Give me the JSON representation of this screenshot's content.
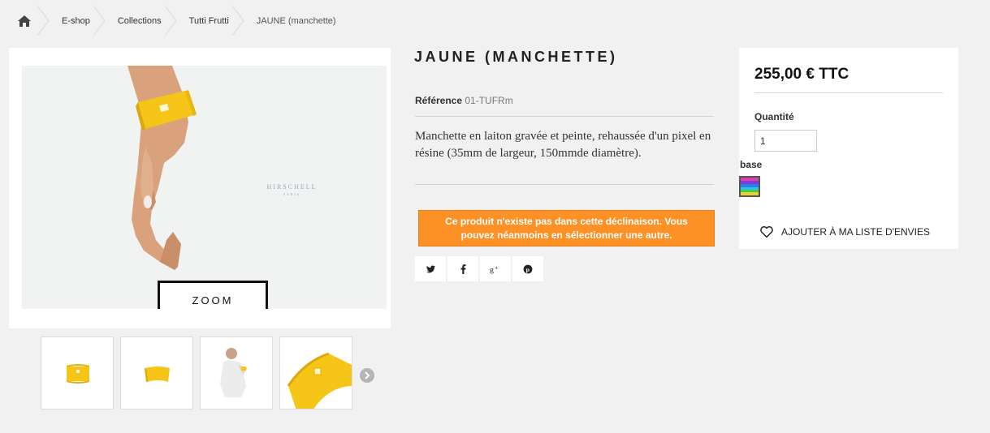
{
  "breadcrumb": {
    "home_icon": "home-icon",
    "items": [
      "E-shop",
      "Collections",
      "Tutti Frutti",
      "JAUNE (manchette)"
    ]
  },
  "gallery": {
    "zoom_label": "ZOOM",
    "brand_logo_text": "HIRSCHELL",
    "brand_logo_sub": "PARIS",
    "next_icon": "chevron-right-icon",
    "thumbnail_count": 4
  },
  "product": {
    "title": "JAUNE (MANCHETTE)",
    "reference_label": "Référence",
    "reference_value": "01-TUFRm",
    "description": "Manchette en laiton gravée et peinte, rehaussée d'un pixel en résine (35mm de largeur, 150mmde diamètre).",
    "warning": "Ce produit n'existe pas dans cette déclinaison. Vous pouvez néanmoins en sélectionner une autre."
  },
  "social": [
    "twitter-icon",
    "facebook-icon",
    "google-plus-icon",
    "pinterest-icon"
  ],
  "buy": {
    "price": "255,00 € TTC",
    "quantity_label": "Quantité",
    "quantity_value": "1",
    "base_label": "base",
    "wishlist_label": "AJOUTER À MA LISTE D'ENVIES",
    "wishlist_icon": "heart-icon"
  },
  "colors": {
    "background": "#f1f1f1",
    "warning": "#fe9126",
    "product_yellow": "#f5c518"
  }
}
